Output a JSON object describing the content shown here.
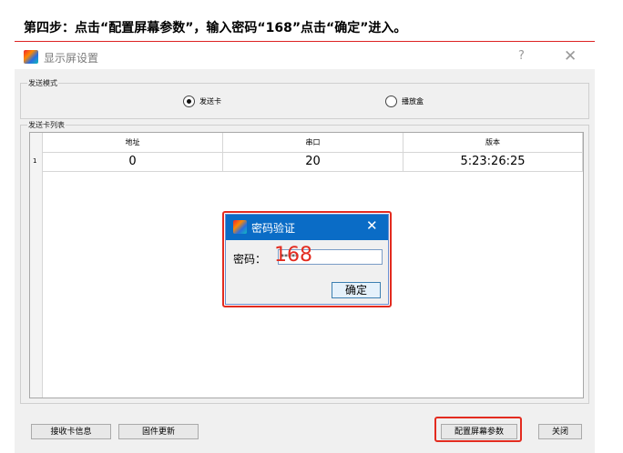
{
  "instruction": {
    "text": "第四步：点击“配置屏幕参数”，输入密码“168”点击“确定”进入。"
  },
  "window": {
    "title": "显示屏设置",
    "help": "?",
    "close": "✕",
    "send_mode": {
      "label": "发送模式",
      "options": [
        "发送卡",
        "播放盒"
      ],
      "selected": "发送卡"
    },
    "card_list": {
      "label": "发送卡列表",
      "columns": [
        "地址",
        "串口",
        "版本"
      ],
      "rows": [
        {
          "index": "1",
          "address": "0",
          "serial": "20",
          "version": "5:23:26:25"
        }
      ]
    },
    "buttons": {
      "receiver_info": "接收卡信息",
      "firmware_update": "固件更新",
      "configure_screen": "配置屏幕参数",
      "close": "关闭"
    }
  },
  "password_dialog": {
    "title": "密码验证",
    "close": "✕",
    "label": "密码：",
    "masked_value": "*****",
    "annotation": "168",
    "ok": "确定"
  },
  "colors": {
    "highlight": "#e32b1f",
    "dialog_titlebar": "#0a6cc6"
  }
}
